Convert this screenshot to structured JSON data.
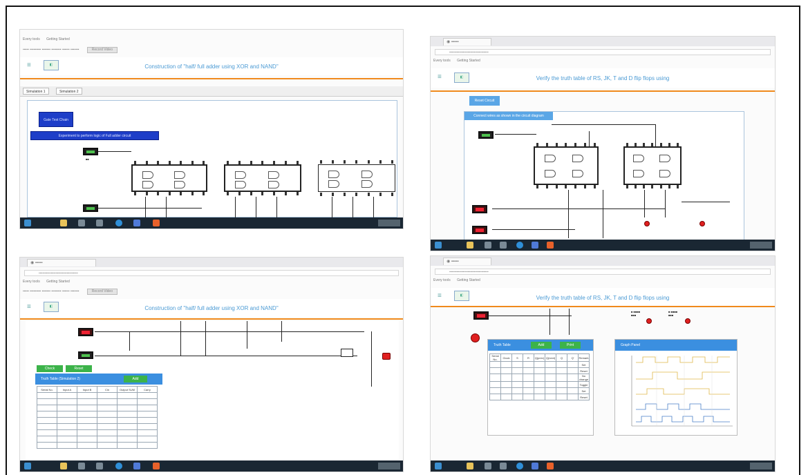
{
  "screens": {
    "top_left": {
      "title": "Construction of \"half/ full adder using XOR and NAND\"",
      "tabs": [
        "Simulation 1",
        "Simulation 2"
      ],
      "primary_button": "Gate Test Chain",
      "instruction_bar": "Experiment to perform logic of Full adder circuit"
    },
    "top_right": {
      "title": "Verify the truth table of RS, JK, T and D flip flops using",
      "primary_button": "Reset Circuit",
      "instruction_bar": "Connect wires as shown in the circuit diagram"
    },
    "bottom_left": {
      "title": "Construction of \"half/ full adder using XOR and NAND\"",
      "truth_table_header": "Truth Table (Simulation 2)",
      "add_button": "Add",
      "green_buttons": [
        "Check",
        "Reset"
      ],
      "table_columns": [
        "Serial No.",
        "Input A",
        "Input B",
        "Cin",
        "Output SUM",
        "Carry"
      ],
      "table_rows": 9
    },
    "bottom_right": {
      "title": "Verify the truth table of RS, JK, T and D flip flops using",
      "table_header": "Truth Table",
      "table_buttons": [
        "Add",
        "Print"
      ],
      "graph_header": "Graph Panel",
      "side_labels": [
        "Set",
        "Reset",
        "No change",
        "Toggle",
        "Set",
        "Reset"
      ],
      "table_columns": [
        "Serial No.",
        "Clock",
        "S",
        "R",
        "Q(prev)",
        "Q(next)",
        "Q",
        "Q'",
        "Remark"
      ]
    }
  },
  "browser": {
    "bookmarks": [
      "Every tools",
      "Getting Started"
    ],
    "notify_button": "Record Video"
  },
  "colors": {
    "accent_orange": "#f08a1c",
    "title_blue": "#4a9ad4",
    "button_blue": "#1e3ec8",
    "panel_blue": "#3b8fe0",
    "switch_green": "#4ec24e",
    "switch_red": "#e22233",
    "taskbar": "#1a2733"
  }
}
